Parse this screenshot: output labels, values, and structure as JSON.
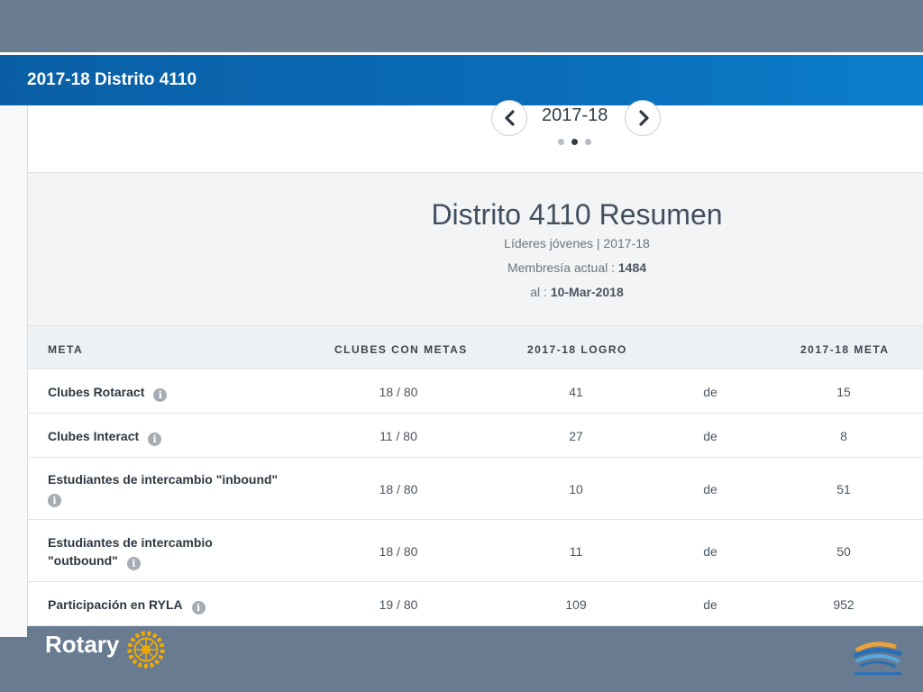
{
  "header": {
    "title": "2017-18 Distrito 4110"
  },
  "year_nav": {
    "year": "2017-18",
    "prev_icon": "chevron-left-icon",
    "next_icon": "chevron-right-icon",
    "dots": 3,
    "active_dot": 1
  },
  "summary": {
    "title": "Distrito 4110 Resumen",
    "subtitle": "Líderes jóvenes | 2017-18",
    "membership_label": "Membresía actual : ",
    "membership_value": "1484",
    "date_label": "al : ",
    "date_value": "10-Mar-2018"
  },
  "table": {
    "headers": {
      "meta": "META",
      "clubes": "CLUBES CON METAS",
      "logro": "2017-18 LOGRO",
      "target": "2017-18 META"
    },
    "rows": [
      {
        "name": "Clubes Rotaract",
        "clubes": "18 / 80",
        "logro": "41",
        "de": "de",
        "target": "15"
      },
      {
        "name": "Clubes Interact",
        "clubes": "11 / 80",
        "logro": "27",
        "de": "de",
        "target": "8"
      },
      {
        "name": "Estudiantes de intercambio \"inbound\"",
        "clubes": "18 / 80",
        "logro": "10",
        "de": "de",
        "target": "51"
      },
      {
        "name": "Estudiantes de intercambio \"outbound\"",
        "clubes": "18 / 80",
        "logro": "11",
        "de": "de",
        "target": "50"
      },
      {
        "name": "Participación en RYLA",
        "clubes": "19 / 80",
        "logro": "109",
        "de": "de",
        "target": "952"
      }
    ]
  },
  "footer": {
    "logo_text": "Rotary"
  },
  "colors": {
    "header_blue": "#0a6db9",
    "footer_gray": "#687b91",
    "wheel_gold": "#f2a900"
  }
}
